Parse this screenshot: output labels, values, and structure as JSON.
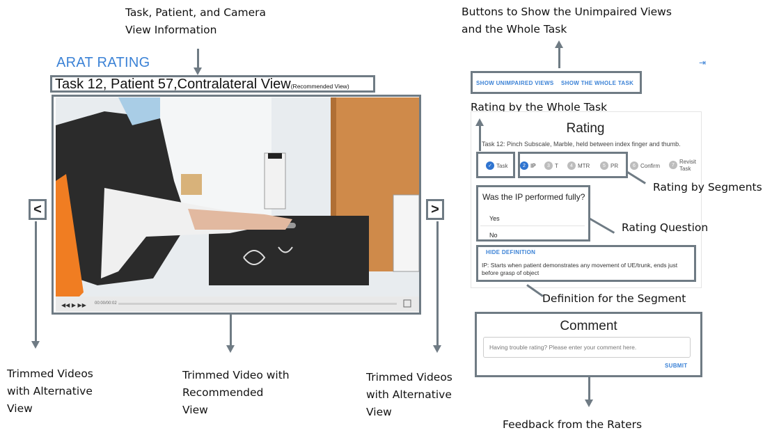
{
  "annotations": {
    "task_info": [
      "Task, Patient, and Camera",
      "View Information"
    ],
    "buttons_info": [
      "Buttons to Show the Unimpaired Views",
      "and the Whole Task"
    ],
    "rating_whole": "Rating by the Whole Task",
    "rating_segments": "Rating by Segments",
    "rating_question": "Rating Question",
    "definition": "Definition for the Segment",
    "feedback": "Feedback from the Raters",
    "trimmed_left": [
      "Trimmed Videos",
      "with Alternative",
      "View"
    ],
    "trimmed_center": [
      "Trimmed Video with",
      "Recommended",
      "View"
    ],
    "trimmed_right": [
      "Trimmed Videos",
      "with Alternative",
      "View"
    ]
  },
  "app": {
    "title": "ARAT RATING",
    "task_title": "Task 12, Patient 57,Contralateral View",
    "recommended_tag": "(Recommended View)"
  },
  "video": {
    "time": "00:00/00:02",
    "prev_glyph": "<",
    "next_glyph": ">"
  },
  "top_buttons": {
    "show_unimpaired": "SHOW UNIMPAIRED VIEWS",
    "show_whole": "SHOW THE WHOLE TASK"
  },
  "rating": {
    "title": "Rating",
    "subtitle": "Task 12: Pinch Subscale, Marble, held between index finger and thumb.",
    "steps": [
      {
        "num": "✓",
        "label": "Task"
      },
      {
        "num": "2",
        "label": "IP"
      },
      {
        "num": "3",
        "label": "T"
      },
      {
        "num": "4",
        "label": "MTR"
      },
      {
        "num": "5",
        "label": "PR"
      },
      {
        "num": "6",
        "label": "Confirm"
      },
      {
        "num": "7",
        "label": "Revisit"
      },
      {
        "num": "",
        "label": "Task"
      }
    ],
    "question": "Was the IP performed fully?",
    "options": [
      "Yes",
      "No"
    ],
    "hide_definition": "HIDE DEFINITION",
    "definition_text": "IP: Starts when patient demonstrates any movement of UE/trunk, ends just before grasp of object"
  },
  "comment": {
    "title": "Comment",
    "placeholder": "Having trouble rating? Please enter your comment here.",
    "submit": "SUBMIT"
  },
  "colors": {
    "accent": "#3b82d6",
    "frame": "#6f7b84"
  }
}
